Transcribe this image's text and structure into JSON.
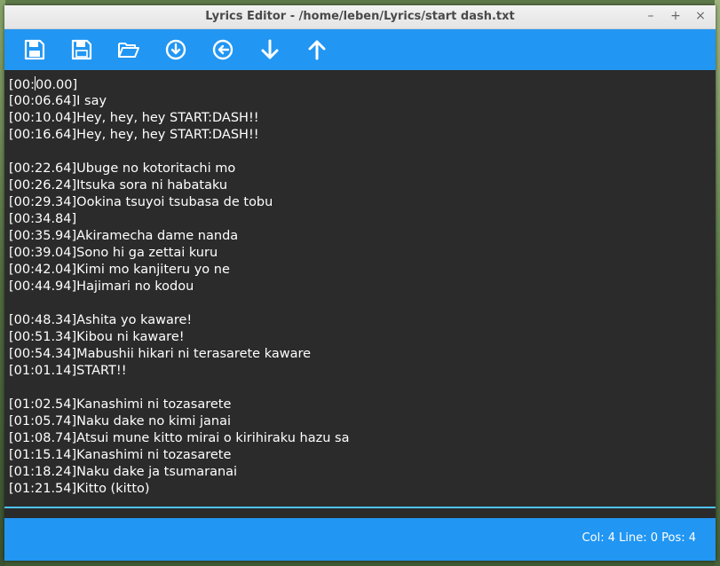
{
  "window": {
    "title": "Lyrics Editor - /home/leben/Lyrics/start dash.txt"
  },
  "window_controls": [
    {
      "name": "minimize-button",
      "label": "–"
    },
    {
      "name": "maximize-button",
      "label": "+"
    },
    {
      "name": "close-button",
      "label": "×"
    }
  ],
  "toolbar": {
    "buttons": [
      {
        "name": "save-button",
        "icon": "floppy-disk-icon"
      },
      {
        "name": "save-as-button",
        "icon": "floppy-disk-outline-icon"
      },
      {
        "name": "open-folder-button",
        "icon": "folder-open-icon"
      },
      {
        "name": "download-button",
        "icon": "arrow-down-circle-icon"
      },
      {
        "name": "back-button",
        "icon": "arrow-left-circle-icon"
      },
      {
        "name": "move-down-button",
        "icon": "arrow-down-icon"
      },
      {
        "name": "move-up-button",
        "icon": "arrow-up-icon"
      }
    ],
    "color": "#2196f3"
  },
  "editor": {
    "cursor_line": 0,
    "cursor_col": 4,
    "lines": [
      "[00:00.00]",
      "[00:06.64]I say",
      "[00:10.04]Hey, hey, hey START:DASH!!",
      "[00:16.64]Hey, hey, hey START:DASH!!",
      "",
      "[00:22.64]Ubuge no kotoritachi mo",
      "[00:26.24]Itsuka sora ni habataku",
      "[00:29.34]Ookina tsuyoi tsubasa de tobu",
      "[00:34.84]",
      "[00:35.94]Akiramecha dame nanda",
      "[00:39.04]Sono hi ga zettai kuru",
      "[00:42.04]Kimi mo kanjiteru yo ne",
      "[00:44.94]Hajimari no kodou",
      "",
      "[00:48.34]Ashita yo kaware!",
      "[00:51.34]Kibou ni kaware!",
      "[00:54.34]Mabushii hikari ni terasarete kaware",
      "[01:01.14]START!!",
      "",
      "[01:02.54]Kanashimi ni tozasarete",
      "[01:05.74]Naku dake no kimi janai",
      "[01:08.74]Atsui mune kitto mirai o kirihiraku hazu sa",
      "[01:15.14]Kanashimi ni tozasarete",
      "[01:18.24]Naku dake ja tsumaranai",
      "[01:21.54]Kitto (kitto)"
    ]
  },
  "status": {
    "text": "Col: 4 Line: 0 Pos: 4"
  }
}
